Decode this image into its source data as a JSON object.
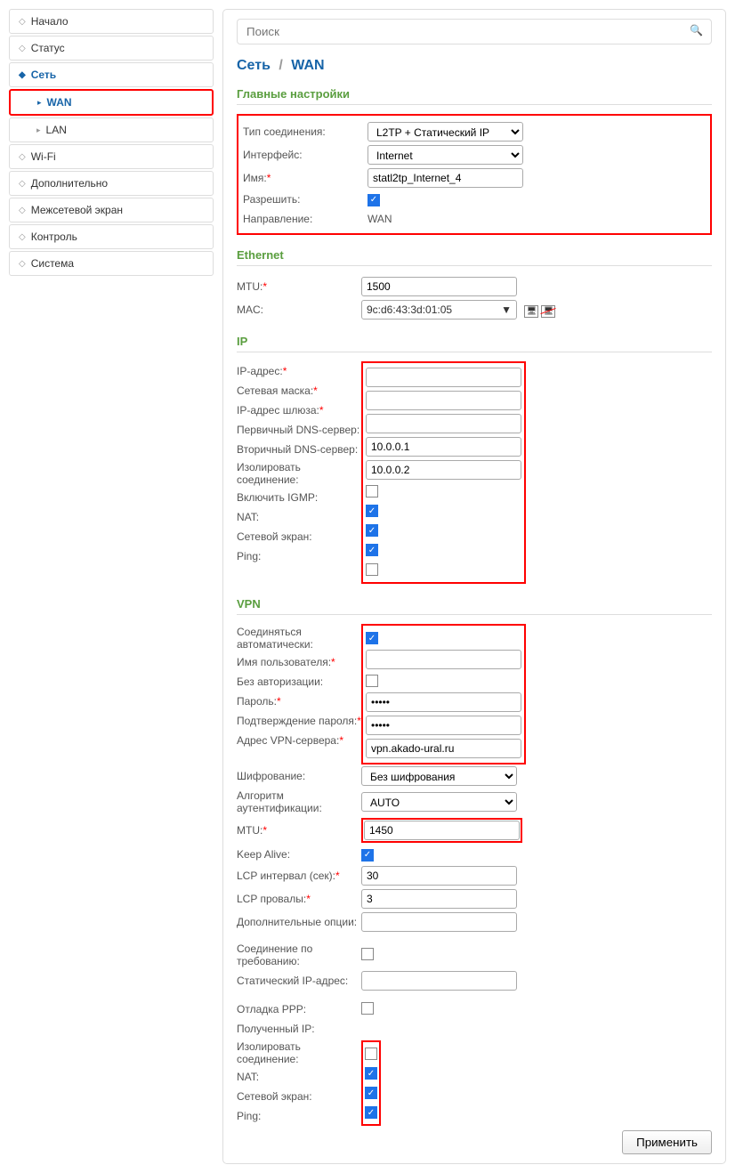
{
  "sidebar": {
    "items": [
      {
        "label": "Начало"
      },
      {
        "label": "Статус"
      },
      {
        "label": "Сеть",
        "active": true
      },
      {
        "label": "WAN",
        "sub": true,
        "highlighted": true
      },
      {
        "label": "LAN",
        "sub": true
      },
      {
        "label": "Wi-Fi"
      },
      {
        "label": "Дополнительно"
      },
      {
        "label": "Межсетевой экран"
      },
      {
        "label": "Контроль"
      },
      {
        "label": "Система"
      }
    ]
  },
  "search": {
    "placeholder": "Поиск"
  },
  "breadcrumb": {
    "part1": "Сеть",
    "sep": "/",
    "part2": "WAN"
  },
  "sections": {
    "main": {
      "title": "Главные настройки",
      "conn_type_label": "Тип соединения:",
      "conn_type_value": "L2TP + Статический IP",
      "interface_label": "Интерфейс:",
      "interface_value": "Internet",
      "name_label": "Имя:",
      "name_value": "statl2tp_Internet_4",
      "allow_label": "Разрешить:",
      "direction_label": "Направление:",
      "direction_value": "WAN"
    },
    "ethernet": {
      "title": "Ethernet",
      "mtu_label": "MTU:",
      "mtu_value": "1500",
      "mac_label": "MAC:",
      "mac_value": "9c:d6:43:3d:01:05"
    },
    "ip": {
      "title": "IP",
      "ip_label": "IP-адрес:",
      "ip_value": "",
      "mask_label": "Сетевая маска:",
      "mask_value": "",
      "gateway_label": "IP-адрес шлюза:",
      "gateway_value": "",
      "dns1_label": "Первичный DNS-сервер:",
      "dns1_value": "10.0.0.1",
      "dns2_label": "Вторичный DNS-сервер:",
      "dns2_value": "10.0.0.2",
      "isolate_label": "Изолировать соединение:",
      "igmp_label": "Включить IGMP:",
      "nat_label": "NAT:",
      "firewall_label": "Сетевой экран:",
      "ping_label": "Ping:"
    },
    "vpn": {
      "title": "VPN",
      "auto_label": "Соединяться автоматически:",
      "user_label": "Имя пользователя:",
      "user_value": "",
      "noauth_label": "Без авторизации:",
      "pass_label": "Пароль:",
      "pass_value": "•••••",
      "pass2_label": "Подтверждение пароля:",
      "pass2_value": "•••••",
      "server_label": "Адрес VPN-сервера:",
      "server_value": "vpn.akado-ural.ru",
      "enc_label": "Шифрование:",
      "enc_value": "Без шифрования",
      "auth_label": "Алгоритм аутентификации:",
      "auth_value": "AUTO",
      "mtu_label": "MTU:",
      "mtu_value": "1450",
      "keepalive_label": "Keep Alive:",
      "lcp_int_label": "LCP интервал (сек):",
      "lcp_int_value": "30",
      "lcp_fail_label": "LCP провалы:",
      "lcp_fail_value": "3",
      "extra_label": "Дополнительные опции:",
      "extra_value": "",
      "ondemand_label": "Соединение по требованию:",
      "static_ip_label": "Статический IP-адрес:",
      "static_ip_value": "",
      "debug_label": "Отладка PPP:",
      "received_ip_label": "Полученный IP:",
      "isolate_label": "Изолировать соединение:",
      "nat_label": "NAT:",
      "firewall_label": "Сетевой экран:",
      "ping_label": "Ping:"
    }
  },
  "apply_button": "Применить"
}
